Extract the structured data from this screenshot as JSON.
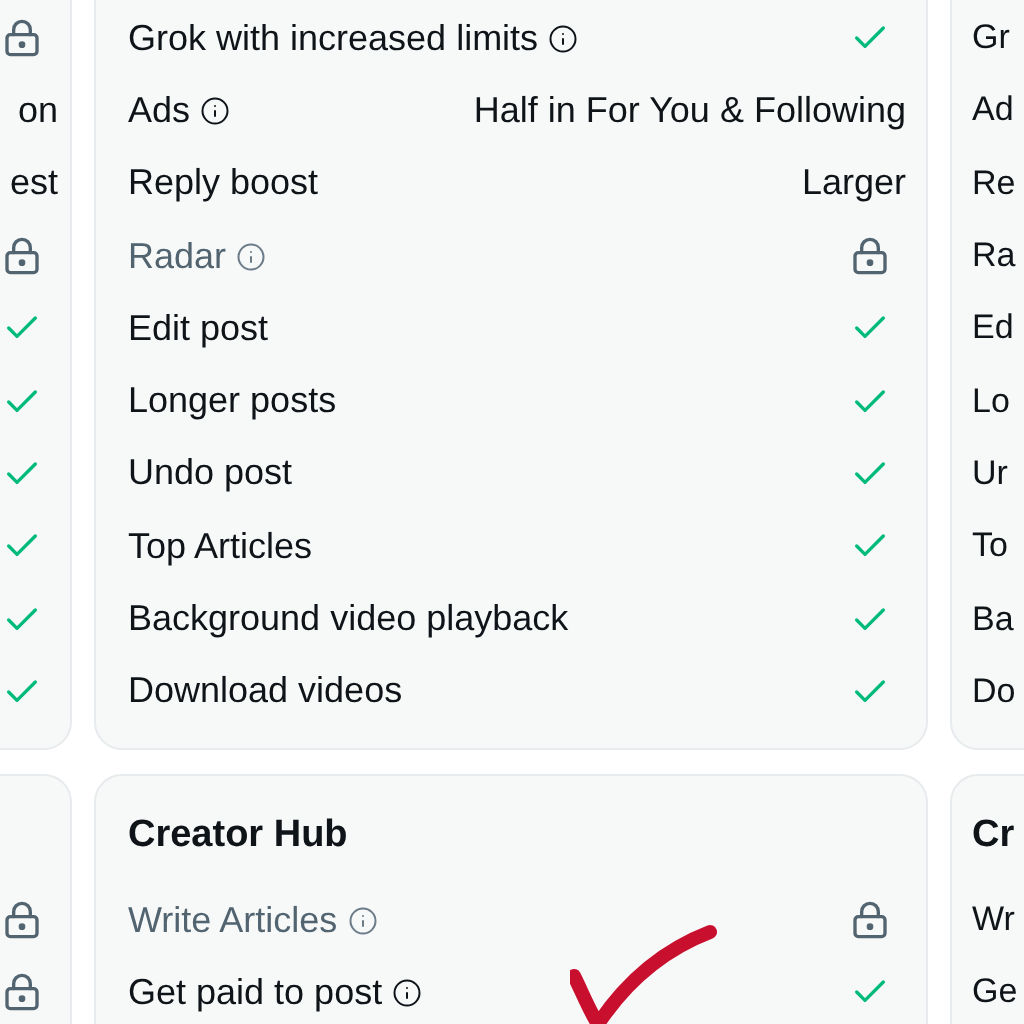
{
  "left_column": [
    {
      "rows": [
        {
          "kind": "lock"
        },
        {
          "kind": "text",
          "value": "on"
        },
        {
          "kind": "text",
          "value": "est"
        },
        {
          "kind": "lock"
        },
        {
          "kind": "check"
        },
        {
          "kind": "check"
        },
        {
          "kind": "check"
        },
        {
          "kind": "check"
        },
        {
          "kind": "check"
        },
        {
          "kind": "check"
        }
      ]
    },
    {
      "rows": [
        {
          "kind": "lock"
        },
        {
          "kind": "lock"
        }
      ]
    }
  ],
  "middle_column": [
    {
      "rows": [
        {
          "label": "Grok with increased limits",
          "info": true,
          "disabled": false,
          "kind": "check"
        },
        {
          "label": "Ads",
          "info": true,
          "disabled": false,
          "kind": "text",
          "value": "Half in For You & Following"
        },
        {
          "label": "Reply boost",
          "info": false,
          "disabled": false,
          "kind": "text",
          "value": "Larger"
        },
        {
          "label": "Radar",
          "info": true,
          "disabled": true,
          "kind": "lock"
        },
        {
          "label": "Edit post",
          "info": false,
          "disabled": false,
          "kind": "check"
        },
        {
          "label": "Longer posts",
          "info": false,
          "disabled": false,
          "kind": "check"
        },
        {
          "label": "Undo post",
          "info": false,
          "disabled": false,
          "kind": "check"
        },
        {
          "label": "Top Articles",
          "info": false,
          "disabled": false,
          "kind": "check"
        },
        {
          "label": "Background video playback",
          "info": false,
          "disabled": false,
          "kind": "check"
        },
        {
          "label": "Download videos",
          "info": false,
          "disabled": false,
          "kind": "check"
        }
      ]
    },
    {
      "title": "Creator Hub",
      "rows": [
        {
          "label": "Write Articles",
          "info": true,
          "disabled": true,
          "kind": "lock"
        },
        {
          "label": "Get paid to post",
          "info": true,
          "disabled": false,
          "kind": "check"
        }
      ]
    }
  ],
  "right_column": [
    {
      "rows": [
        {
          "label": "Gr"
        },
        {
          "label": "Ad"
        },
        {
          "label": "Re"
        },
        {
          "label": "Ra"
        },
        {
          "label": "Ed"
        },
        {
          "label": "Lo"
        },
        {
          "label": "Ur"
        },
        {
          "label": "To"
        },
        {
          "label": "Ba"
        },
        {
          "label": "Do"
        }
      ]
    },
    {
      "title": "Cr",
      "rows": [
        {
          "label": "Wr"
        },
        {
          "label": "Ge"
        }
      ]
    }
  ],
  "annotation": {
    "kind": "check"
  }
}
